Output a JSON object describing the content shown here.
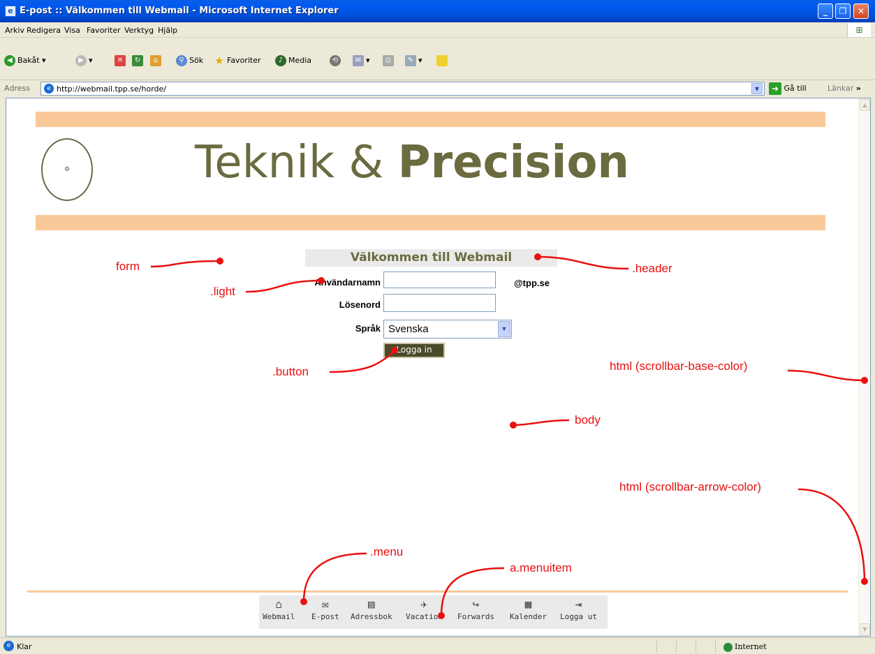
{
  "window": {
    "title": "E-post :: Välkommen till Webmail - Microsoft Internet Explorer"
  },
  "menubar": [
    "Arkiv",
    "Redigera",
    "Visa",
    "Favoriter",
    "Verktyg",
    "Hjälp"
  ],
  "toolbar": {
    "back": "Bakåt",
    "search": "Sök",
    "favorites": "Favoriter",
    "media": "Media"
  },
  "addressbar": {
    "label": "Adress",
    "url": "http://webmail.tpp.se/horde/",
    "go": "Gå till",
    "links": "Länkar",
    "links_more": "»"
  },
  "page": {
    "logo_text_1": "Teknik &",
    "logo_text_2": "Precision",
    "welcome": "Välkommen till Webmail",
    "username_label": "Användarnamn",
    "domain": "@tpp.se",
    "password_label": "Lösenord",
    "language_label": "Språk",
    "language_value": "Svenska",
    "login_button": "Logga in",
    "menu": [
      {
        "label": "Webmail",
        "icon": "home-icon"
      },
      {
        "label": "E-post",
        "icon": "envelope-icon"
      },
      {
        "label": "Adressbok",
        "icon": "address-book-icon"
      },
      {
        "label": "Vacation",
        "icon": "airplane-icon"
      },
      {
        "label": "Forwards",
        "icon": "forward-icon"
      },
      {
        "label": "Kalender",
        "icon": "calendar-icon"
      },
      {
        "label": "Logga ut",
        "icon": "logout-icon"
      }
    ]
  },
  "annotations": {
    "form": "form",
    "light": ".light",
    "header": ".header",
    "button": ".button",
    "scrollbar_base": "html (scrollbar-base-color)",
    "body": "body",
    "scrollbar_arrow": "html (scrollbar-arrow-color)",
    "menu": ".menu",
    "menuitem": "a.menuitem"
  },
  "statusbar": {
    "status": "Klar",
    "zone": "Internet"
  },
  "colors": {
    "accent_peach": "#f8c898",
    "logo_olive": "#6b6b40",
    "annotation_red": "#e81010"
  }
}
